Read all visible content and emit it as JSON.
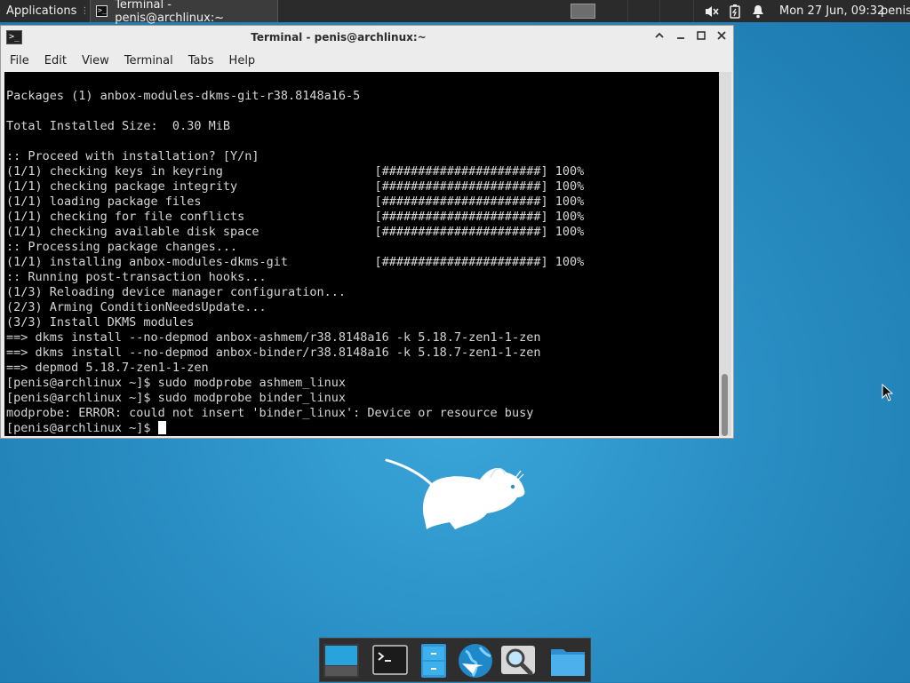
{
  "panel": {
    "applications_label": "Applications",
    "task_label": "Terminal - penis@archlinux:~",
    "clock": "Mon 27 Jun, 09:32",
    "user": "penis"
  },
  "window": {
    "title": "Terminal - penis@archlinux:~",
    "menu": [
      "File",
      "Edit",
      "View",
      "Terminal",
      "Tabs",
      "Help"
    ],
    "scroll": {
      "thumb_start": 0.83,
      "thumb_size": 0.17
    }
  },
  "terminal": {
    "lines": [
      "",
      "Packages (1) anbox-modules-dkms-git-r38.8148a16-5",
      "",
      "Total Installed Size:  0.30 MiB",
      "",
      ":: Proceed with installation? [Y/n]",
      "(1/1) checking keys in keyring                     [######################] 100%",
      "(1/1) checking package integrity                   [######################] 100%",
      "(1/1) loading package files                        [######################] 100%",
      "(1/1) checking for file conflicts                  [######################] 100%",
      "(1/1) checking available disk space                [######################] 100%",
      ":: Processing package changes...",
      "(1/1) installing anbox-modules-dkms-git            [######################] 100%",
      ":: Running post-transaction hooks...",
      "(1/3) Reloading device manager configuration...",
      "(2/3) Arming ConditionNeedsUpdate...",
      "(3/3) Install DKMS modules",
      "==> dkms install --no-depmod anbox-ashmem/r38.8148a16 -k 5.18.7-zen1-1-zen",
      "==> dkms install --no-depmod anbox-binder/r38.8148a16 -k 5.18.7-zen1-1-zen",
      "==> depmod 5.18.7-zen1-1-zen",
      "[penis@archlinux ~]$ sudo modprobe ashmem_linux",
      "[penis@archlinux ~]$ sudo modprobe binder_linux",
      "modprobe: ERROR: could not insert 'binder_linux': Device or resource busy"
    ],
    "prompt": "[penis@archlinux ~]$ "
  },
  "dock": {
    "items": [
      "show-desktop",
      "terminal",
      "file-manager",
      "web-browser",
      "app-finder",
      "folder"
    ]
  },
  "colors": {
    "desktop": "#2a8fc4",
    "panel": "#2b2b2b",
    "terminal_bg": "#000000",
    "terminal_fg": "#d6d6d6"
  }
}
